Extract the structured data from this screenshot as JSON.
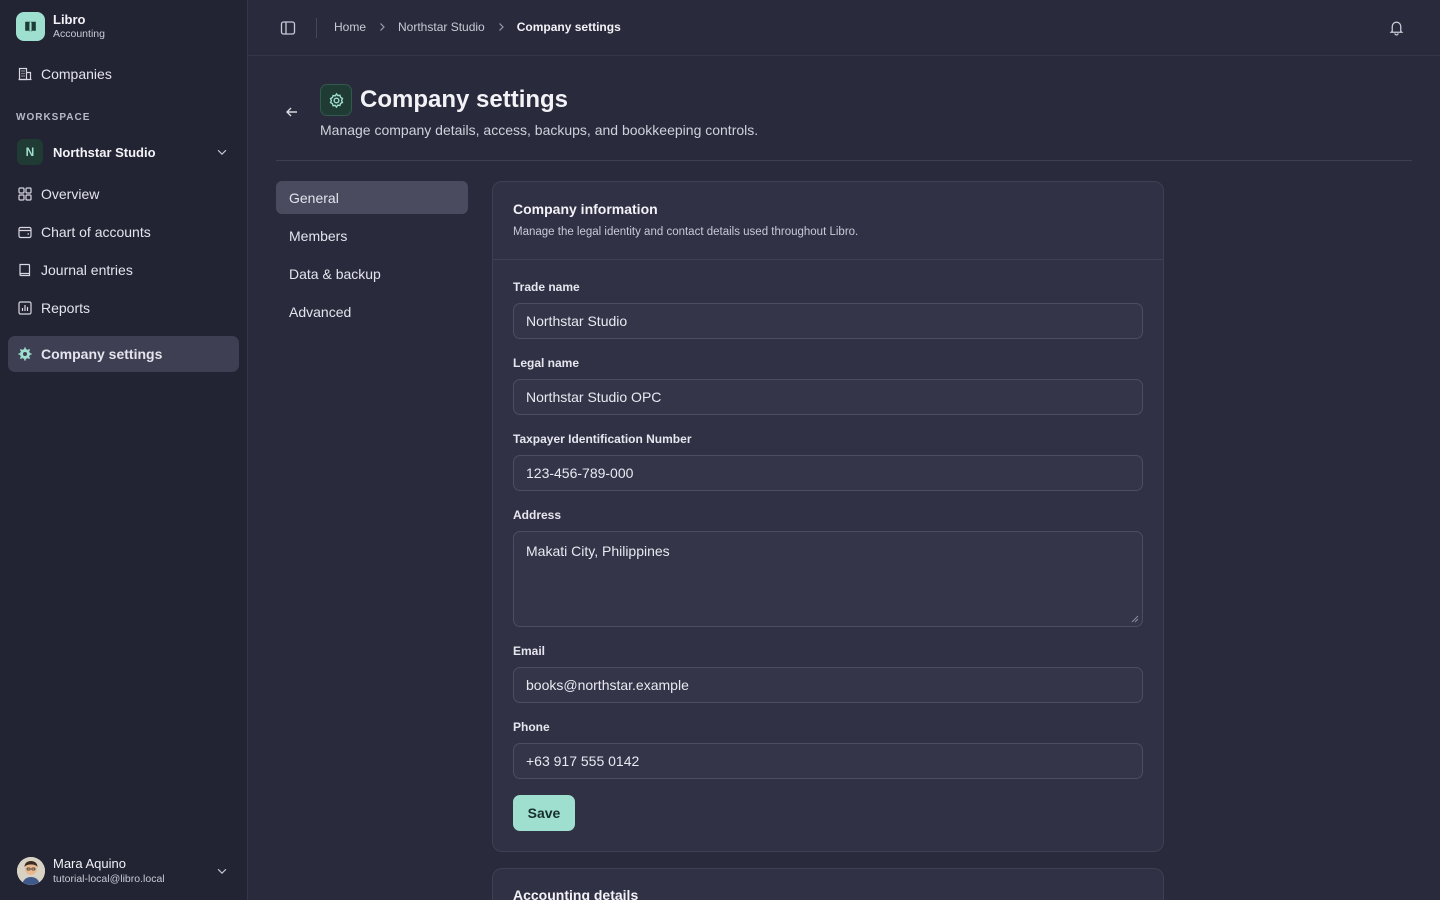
{
  "brand": {
    "name": "Libro",
    "subtitle": "Accounting"
  },
  "sidebar": {
    "companies_label": "Companies",
    "workspace_label": "WORKSPACE",
    "workspace": {
      "initial": "N",
      "name": "Northstar Studio"
    },
    "items": [
      {
        "label": "Overview",
        "icon": "grid-icon"
      },
      {
        "label": "Chart of accounts",
        "icon": "wallet-icon"
      },
      {
        "label": "Journal entries",
        "icon": "book-icon"
      },
      {
        "label": "Reports",
        "icon": "bar-chart-icon"
      },
      {
        "label": "Company settings",
        "icon": "gear-icon",
        "active": true
      }
    ],
    "user": {
      "name": "Mara Aquino",
      "email": "tutorial-local@libro.local"
    }
  },
  "breadcrumb": {
    "home": "Home",
    "company": "Northstar Studio",
    "current": "Company settings"
  },
  "header": {
    "title": "Company settings",
    "subtitle": "Manage company details, access, backups, and bookkeeping controls."
  },
  "subnav": [
    "General",
    "Members",
    "Data & backup",
    "Advanced"
  ],
  "card": {
    "title": "Company information",
    "description": "Manage the legal identity and contact details used throughout Libro.",
    "fields": {
      "trade_name": {
        "label": "Trade name",
        "value": "Northstar Studio"
      },
      "legal_name": {
        "label": "Legal name",
        "value": "Northstar Studio OPC"
      },
      "tin": {
        "label": "Taxpayer Identification Number",
        "value": "123-456-789-000"
      },
      "address": {
        "label": "Address",
        "value": "Makati City, Philippines"
      },
      "email": {
        "label": "Email",
        "value": "books@northstar.example"
      },
      "phone": {
        "label": "Phone",
        "value": "+63 917 555 0142"
      }
    },
    "save_label": "Save"
  },
  "card2": {
    "title": "Accounting details"
  },
  "colors": {
    "accent": "#9fdfcf",
    "background": "#292a3b",
    "sidebar": "#232433",
    "card": "#303144"
  }
}
